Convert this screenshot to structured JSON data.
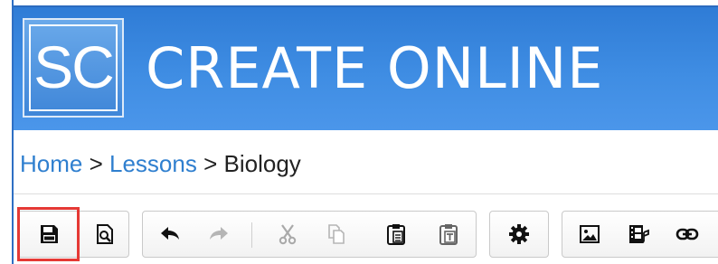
{
  "app": {
    "logo_text": "SC",
    "title": "CREATE ONLINE"
  },
  "breadcrumb": {
    "items": [
      {
        "label": "Home",
        "link": true
      },
      {
        "label": "Lessons",
        "link": true
      },
      {
        "label": "Biology",
        "link": false
      }
    ],
    "separator": ">"
  },
  "toolbar": {
    "groups": [
      {
        "name": "file",
        "buttons": [
          "save-icon",
          "preview-icon"
        ]
      },
      {
        "name": "edit",
        "buttons": [
          "undo-icon",
          "redo-icon",
          "cut-icon",
          "copy-icon",
          "paste-icon",
          "paste-text-icon"
        ]
      },
      {
        "name": "settings",
        "buttons": [
          "gear-icon"
        ]
      },
      {
        "name": "insert",
        "buttons": [
          "image-icon",
          "media-icon",
          "link-icon"
        ]
      }
    ],
    "highlighted": "save-icon"
  },
  "colors": {
    "banner": "#3a87de",
    "link": "#2f7fcf",
    "highlight": "#e53935"
  }
}
